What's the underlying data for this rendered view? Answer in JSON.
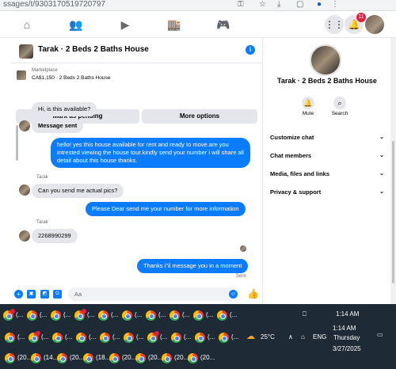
{
  "browser": {
    "url_fragment": "ssages/t/9303170519720797"
  },
  "nav": {
    "notification_count": "11"
  },
  "chat": {
    "title": "Tarak · 2 Beds 2 Baths House",
    "marketplace_label": "Marketplace",
    "listing": "CA$1,150 · 2 Beds 2 Baths House",
    "btn_pending": "Mark as pending",
    "btn_more": "More options",
    "messages": [
      {
        "dir": "in",
        "text": "Hi, is this available?"
      },
      {
        "dir": "in",
        "text": "Message sent"
      },
      {
        "dir": "out",
        "text": "hello! yes this house available for rent and ready to move.are you intrested viewing the house tour.kindly send your number i will share all detail about this house thanks."
      },
      {
        "sender": "Tarak",
        "dir": "in",
        "text": "Can you send me actual pics?"
      },
      {
        "dir": "out",
        "text": "Please Dear send me your number for more information"
      },
      {
        "sender": "Tarak",
        "dir": "in",
        "text": "2268990299"
      },
      {
        "dir": "out",
        "text": "Thanks i\"il message you in a moment"
      }
    ],
    "sender_name": "Tarak",
    "sent_status": "Sent",
    "composer_placeholder": "Aa"
  },
  "info_panel": {
    "name": "Tarak · 2 Beds 2 Baths House",
    "actions": [
      {
        "label": "Mute",
        "icon": "bell-icon"
      },
      {
        "label": "Search",
        "icon": "search-icon"
      }
    ],
    "sections": [
      "Customize chat",
      "Chat members",
      "Media, files and links",
      "Privacy & support"
    ]
  },
  "taskbar": {
    "row1": [
      "(...",
      "(...",
      "(...",
      "(...",
      "(...",
      "(...",
      "(...",
      "(...",
      "(...",
      "(..."
    ],
    "row2": [
      "(...",
      "(...",
      "(...",
      "(...",
      "(...",
      "(...",
      "(...",
      "(...",
      "(...",
      "(..."
    ],
    "row3": [
      "(20...",
      "(14...",
      "(20...",
      "(18...",
      "(20...",
      "(20...",
      "(20...",
      "(20..."
    ],
    "weather": "25°C",
    "language": "ENG",
    "time": "1:14 AM",
    "day": "Thursday",
    "date": "3/27/2025"
  },
  "colors": {
    "messenger_blue": "#0a7cff",
    "bubble_gray": "#e4e6eb",
    "taskbar": "#1e2a36",
    "notification_red": "#e41e3f"
  }
}
